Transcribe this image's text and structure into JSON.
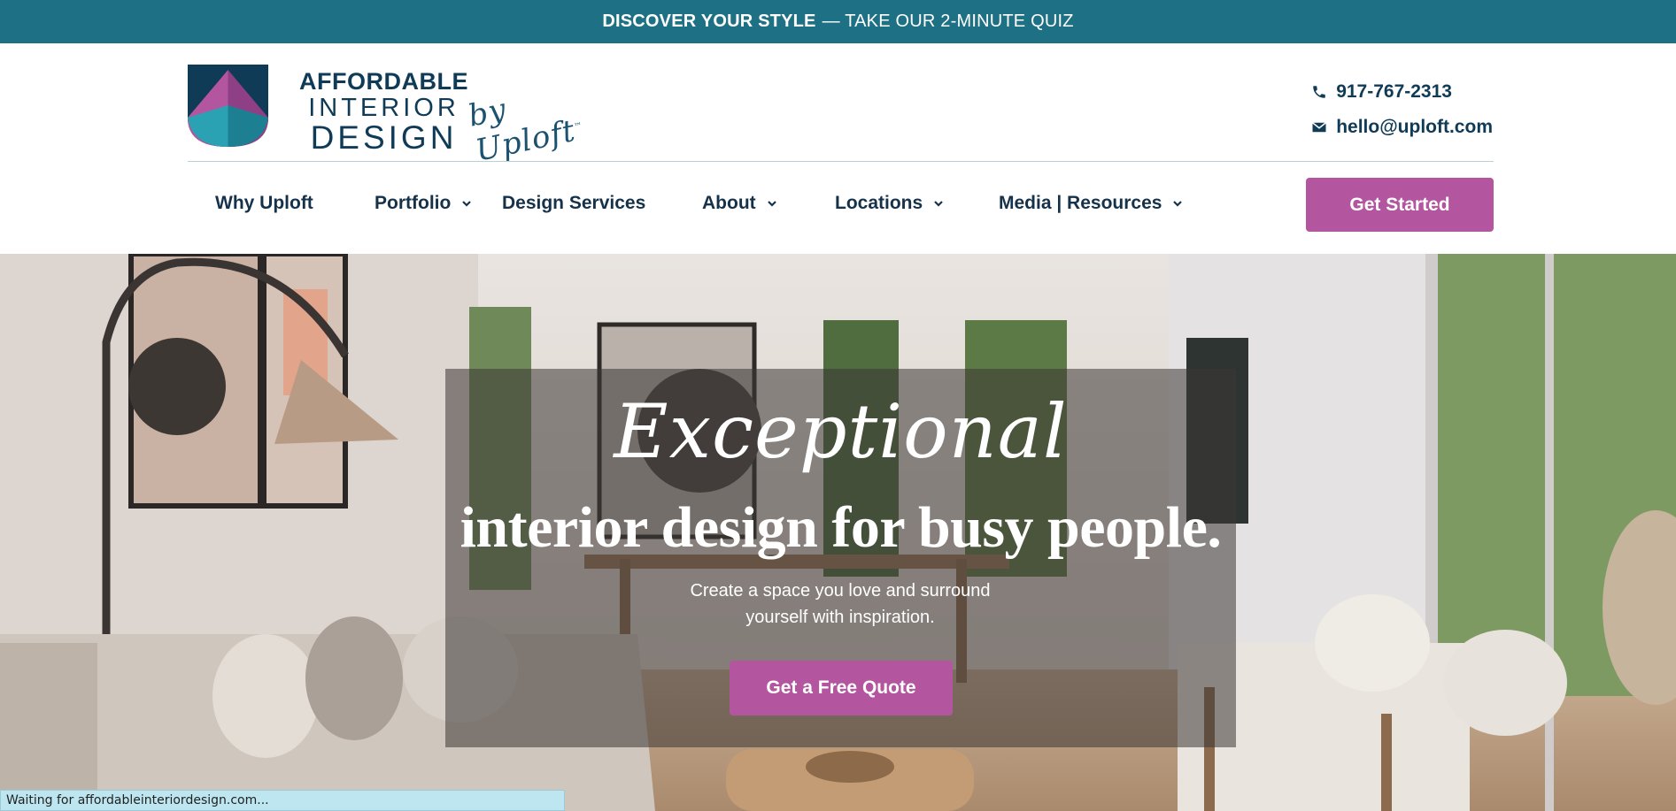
{
  "promo": {
    "strong": "DISCOVER YOUR STYLE",
    "light": "— TAKE OUR 2-MINUTE QUIZ"
  },
  "logo": {
    "line1": "AFFORDABLE",
    "line2": "INTERIOR",
    "line3": "DESIGN",
    "script": "by Uploft",
    "tm": "™"
  },
  "contact": {
    "phone": "917-767-2313",
    "email": "hello@uploft.com"
  },
  "nav": {
    "items": [
      {
        "label": "Why Uploft",
        "dropdown": false
      },
      {
        "label": "Portfolio",
        "dropdown": true
      },
      {
        "label": "Design Services",
        "dropdown": false
      },
      {
        "label": "About",
        "dropdown": true
      },
      {
        "label": "Locations",
        "dropdown": true
      },
      {
        "label": "Media | Resources",
        "dropdown": true
      }
    ],
    "cta": "Get Started"
  },
  "hero": {
    "script": "Exceptional",
    "title": "interior design for busy people.",
    "subtitle": "Create a space you love and surround yourself with inspiration.",
    "cta": "Get a Free Quote"
  },
  "status_bar": {
    "text": "Waiting for affordableinteriordesign.com..."
  },
  "colors": {
    "banner": "#1e7184",
    "brand_navy": "#0f3b57",
    "accent_magenta": "#b4569f",
    "brand_teal": "#2aa2b3"
  }
}
